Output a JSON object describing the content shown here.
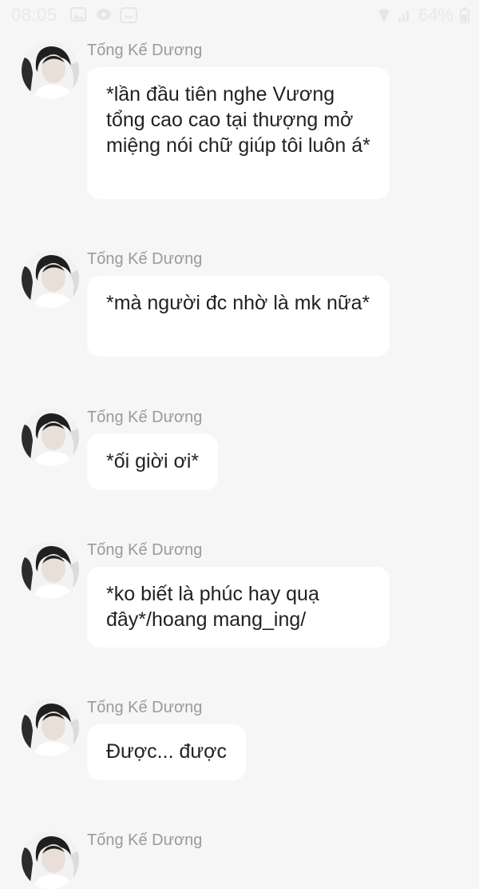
{
  "status_bar": {
    "time": "08:05",
    "battery": "64%"
  },
  "messages": [
    {
      "sender": "Tống Kế Dương",
      "text": "*lần đầu tiên nghe Vương tổng cao cao tại thượng mở miệng nói chữ giúp tôi luôn á*"
    },
    {
      "sender": "Tống Kế Dương",
      "text": "*mà người đc nhờ là mk nữa*"
    },
    {
      "sender": "Tống Kế Dương",
      "text": "*ối giời ơi*"
    },
    {
      "sender": "Tống Kế Dương",
      "text": "*ko biết là phúc hay quạ đây*/hoang mang_ing/"
    },
    {
      "sender": "Tống Kế Dương",
      "text": "Được... được"
    },
    {
      "sender": "Tống Kế Dương",
      "text": ""
    }
  ]
}
